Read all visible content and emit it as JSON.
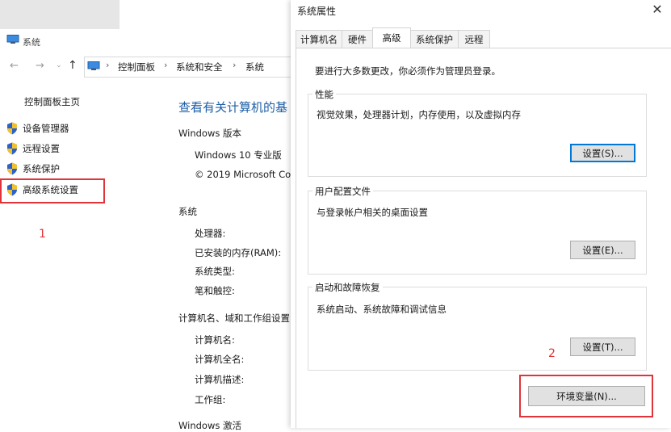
{
  "system_window": {
    "title": "系统",
    "nav": {
      "back": "←",
      "forward": "→",
      "recent": "⌄",
      "up": "↑"
    },
    "breadcrumb": [
      "控制面板",
      "系统和安全",
      "系统"
    ],
    "crumb_separator": "›",
    "sidebar": {
      "home": "控制面板主页",
      "items": [
        {
          "label": "设备管理器",
          "icon": "shield-icon"
        },
        {
          "label": "远程设置",
          "icon": "shield-icon"
        },
        {
          "label": "系统保护",
          "icon": "shield-icon"
        },
        {
          "label": "高级系统设置",
          "icon": "shield-icon"
        }
      ]
    },
    "annotation_1": "1",
    "main": {
      "heading": "查看有关计算机的基",
      "windows_edition": {
        "title": "Windows 版本",
        "lines": [
          "Windows 10 专业版",
          "© 2019 Microsoft Co"
        ]
      },
      "system": {
        "title": "系统",
        "rows": [
          "处理器:",
          "已安装的内存(RAM):",
          "系统类型:",
          "笔和触控:"
        ]
      },
      "computer_name": {
        "title": "计算机名、域和工作组设置",
        "rows": [
          "计算机名:",
          "计算机全名:",
          "计算机描述:",
          "工作组:"
        ]
      },
      "activation_title": "Windows 激活"
    }
  },
  "dialog": {
    "title": "系统属性",
    "close_glyph": "✕",
    "tabs": [
      {
        "label": "计算机名",
        "active": false
      },
      {
        "label": "硬件",
        "active": false
      },
      {
        "label": "高级",
        "active": true
      },
      {
        "label": "系统保护",
        "active": false
      },
      {
        "label": "远程",
        "active": false
      }
    ],
    "admin_note": "要进行大多数更改，你必须作为管理员登录。",
    "groups": [
      {
        "title": "性能",
        "description": "视觉效果，处理器计划，内存使用，以及虚拟内存",
        "button": "设置(S)..."
      },
      {
        "title": "用户配置文件",
        "description": "与登录帐户相关的桌面设置",
        "button": "设置(E)..."
      },
      {
        "title": "启动和故障恢复",
        "description": "系统启动、系统故障和调试信息",
        "button": "设置(T)..."
      }
    ],
    "annotation_2": "2",
    "env_button": "环境变量(N)..."
  },
  "colors": {
    "accent_link": "#1f5fa7",
    "annotation_red": "#e0343a",
    "button_bg": "#e1e1e1",
    "focus_blue": "#0078d7",
    "shield_blue": "#2a62c9",
    "shield_yellow": "#f2c12e"
  }
}
